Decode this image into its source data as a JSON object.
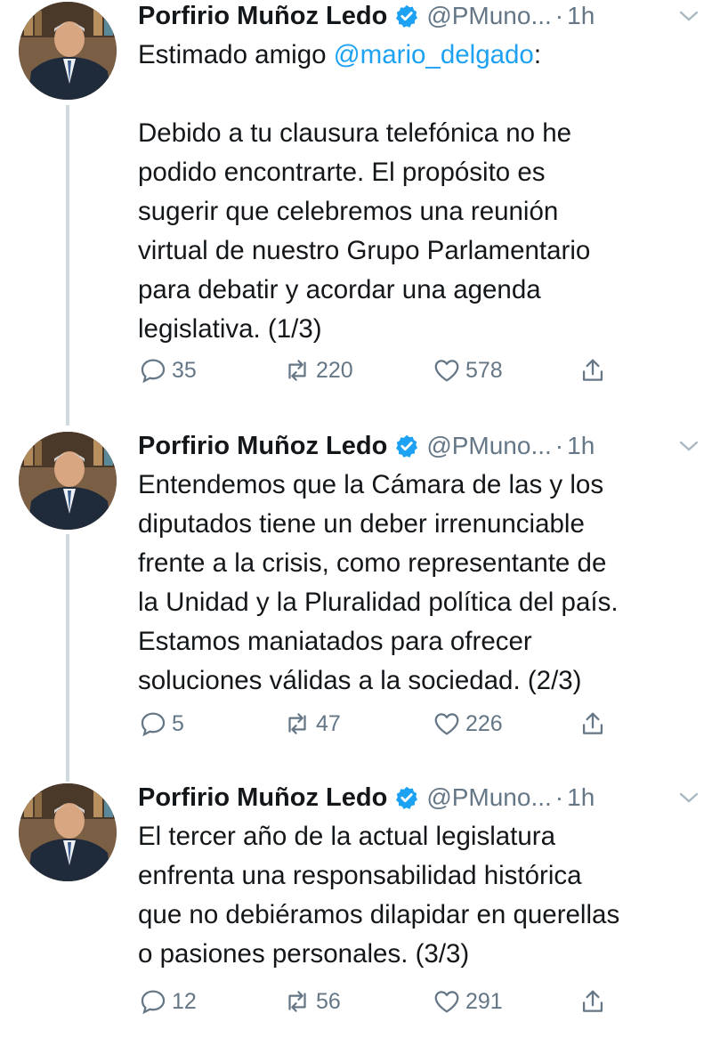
{
  "author": {
    "name": "Porfirio Muñoz Ledo",
    "handle": "@PMuno...",
    "verified": true
  },
  "colors": {
    "accent": "#1da1f2",
    "text": "#14171a",
    "muted": "#657786",
    "thread_line": "#cfd9de"
  },
  "icons": {
    "reply": "reply-icon",
    "retweet": "retweet-icon",
    "like": "heart-icon",
    "share": "share-icon",
    "verified": "verified-badge-icon",
    "menu": "chevron-down-icon"
  },
  "tweets": [
    {
      "time": "1h",
      "separator": "·",
      "greeting_prefix": "Estimado amigo ",
      "mention": "@mario_delgado",
      "greeting_suffix": ":",
      "body_lines": [
        "Debido a tu clausura telefónica no he",
        "podido encontrarte. El propósito es",
        "sugerir que celebremos una reunión",
        "virtual de nuestro Grupo Parlamentario",
        "para debatir y acordar una agenda",
        "legislativa. (1/3)"
      ],
      "replies": "35",
      "retweets": "220",
      "likes": "578"
    },
    {
      "time": "1h",
      "separator": "·",
      "body_lines": [
        "Entendemos que la Cámara de las y los",
        "diputados tiene un deber irrenunciable",
        "frente a la crisis, como representante de",
        "la Unidad y la Pluralidad política del país.",
        "Estamos maniatados para ofrecer",
        "soluciones válidas a la sociedad. (2/3)"
      ],
      "replies": "5",
      "retweets": "47",
      "likes": "226"
    },
    {
      "time": "1h",
      "separator": "·",
      "body_lines": [
        "El tercer año de la actual legislatura",
        "enfrenta una responsabilidad histórica",
        "que no debiéramos dilapidar en querellas",
        "o pasiones personales. (3/3)"
      ],
      "replies": "12",
      "retweets": "56",
      "likes": "291"
    }
  ]
}
